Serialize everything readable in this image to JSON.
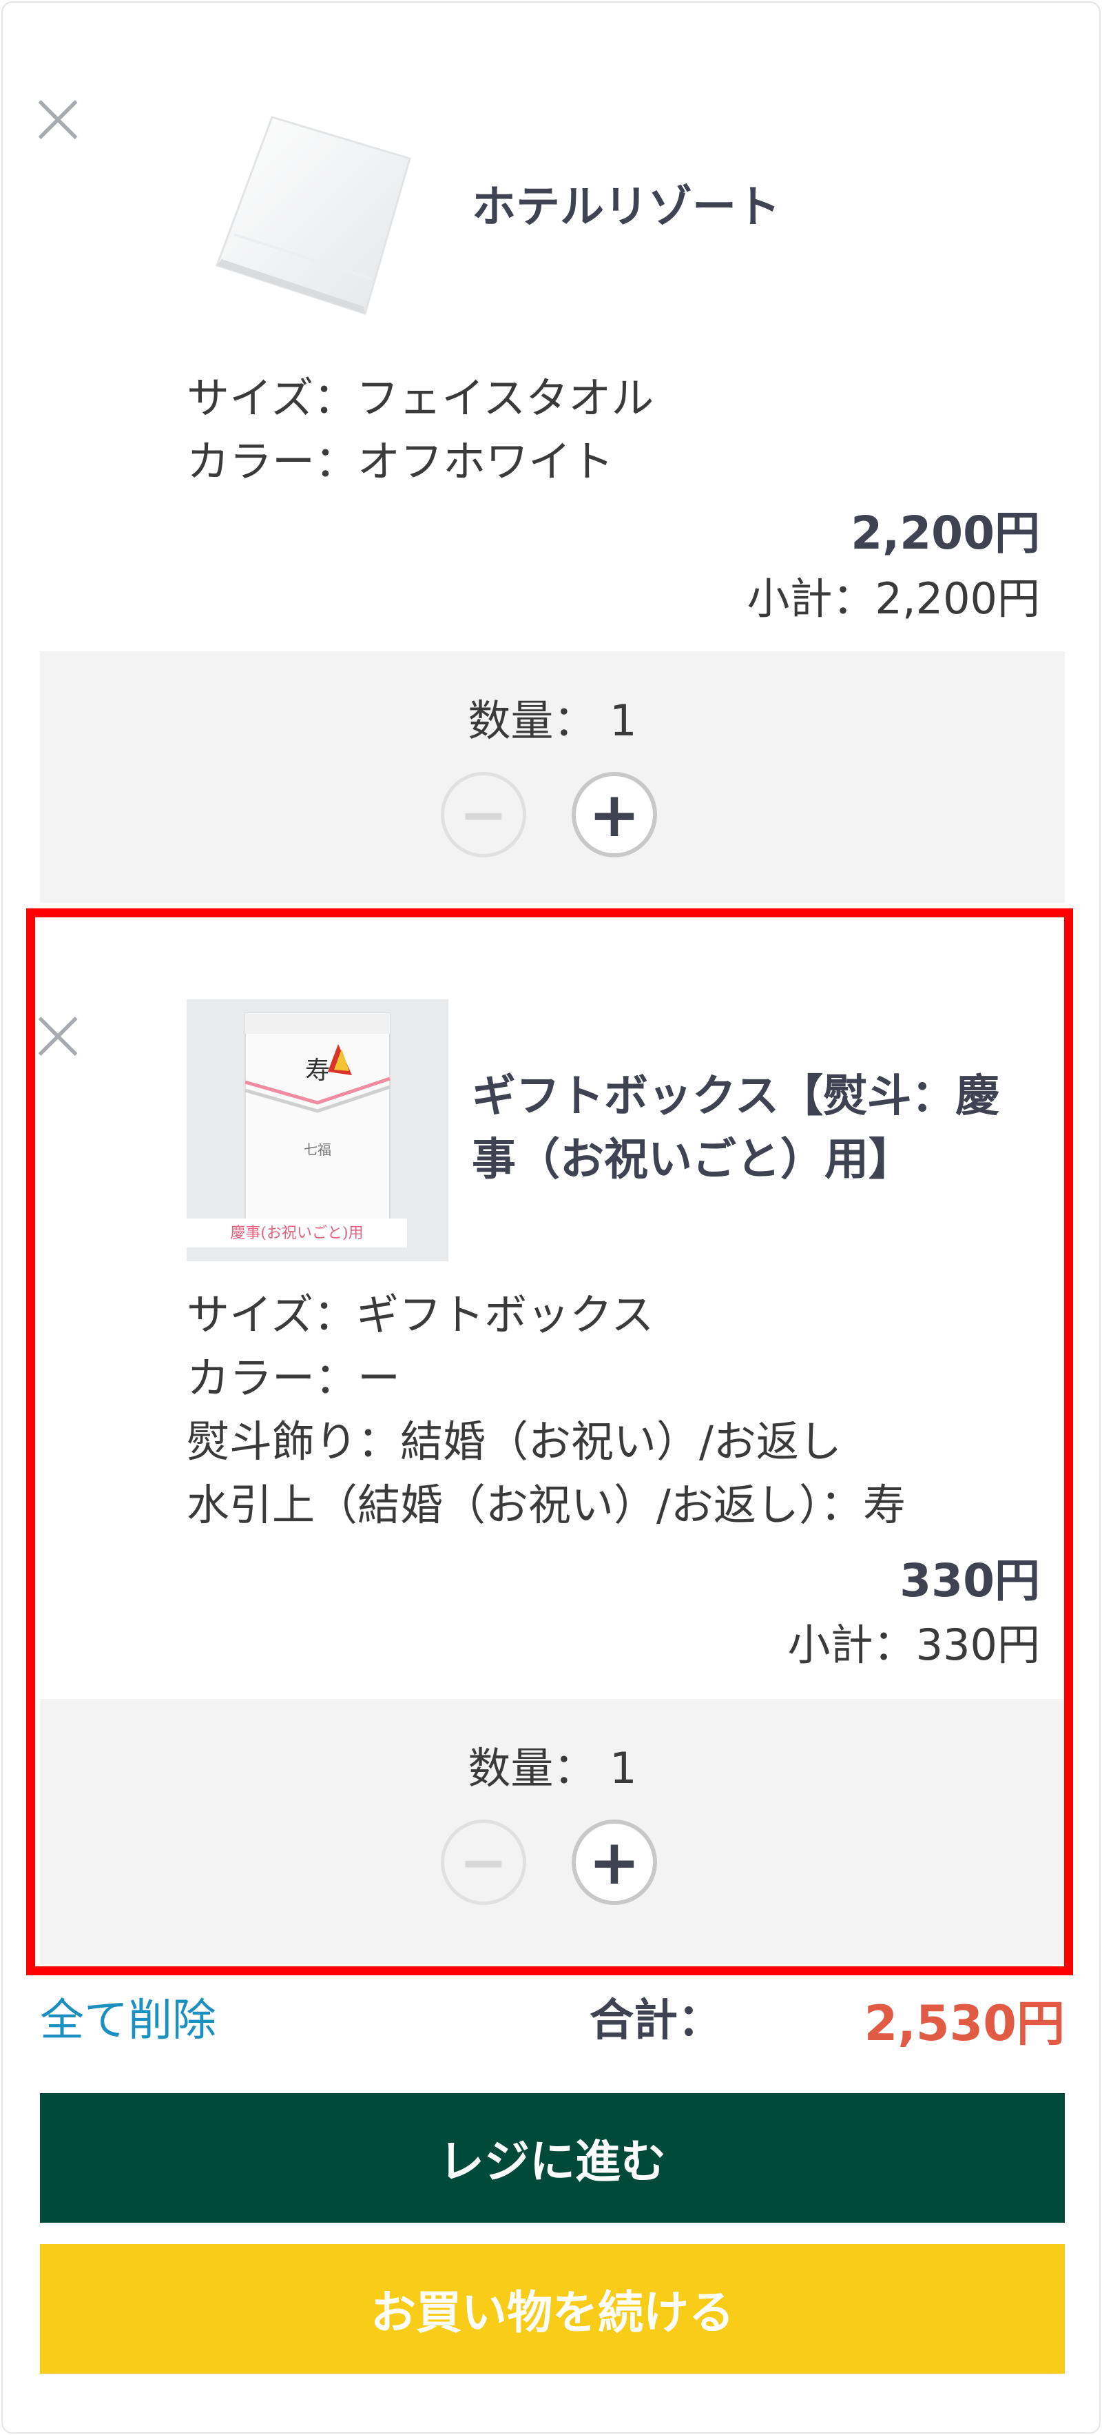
{
  "cart": {
    "items": [
      {
        "name": "ホテルリゾート",
        "options": [
          "サイズ：フェイスタオル",
          "カラー：オフホワイト"
        ],
        "price": "2,200円",
        "subtotal": "小計：2,200円",
        "quantity_label": "数量：",
        "quantity": "1"
      },
      {
        "name_line1": "ギフトボックス【熨斗：慶",
        "name_line2": "事（お祝いごと）用】",
        "box_label": "慶事(お祝いごと)用",
        "options": [
          "サイズ：ギフトボックス",
          "カラー：ー",
          "熨斗飾り：結婚（お祝い）/お返し",
          "水引上（結婚（お祝い）/お返し）：寿"
        ],
        "price": "330円",
        "subtotal": "小計：330円",
        "quantity_label": "数量：",
        "quantity": "1"
      }
    ]
  },
  "footer": {
    "clear_all": "全て削除",
    "total_label": "合計：",
    "total_value": "2,530円"
  },
  "buttons": {
    "checkout": "レジに進む",
    "continue": "お買い物を続ける"
  },
  "colors": {
    "checkout_bg": "#004a39",
    "continue_bg": "#f8cc17",
    "total_price": "#e05a44",
    "link": "#1a8fc0",
    "highlight": "#ff0000"
  },
  "icons": {
    "remove": "close-icon",
    "decrease": "minus-icon",
    "increase": "plus-icon"
  }
}
